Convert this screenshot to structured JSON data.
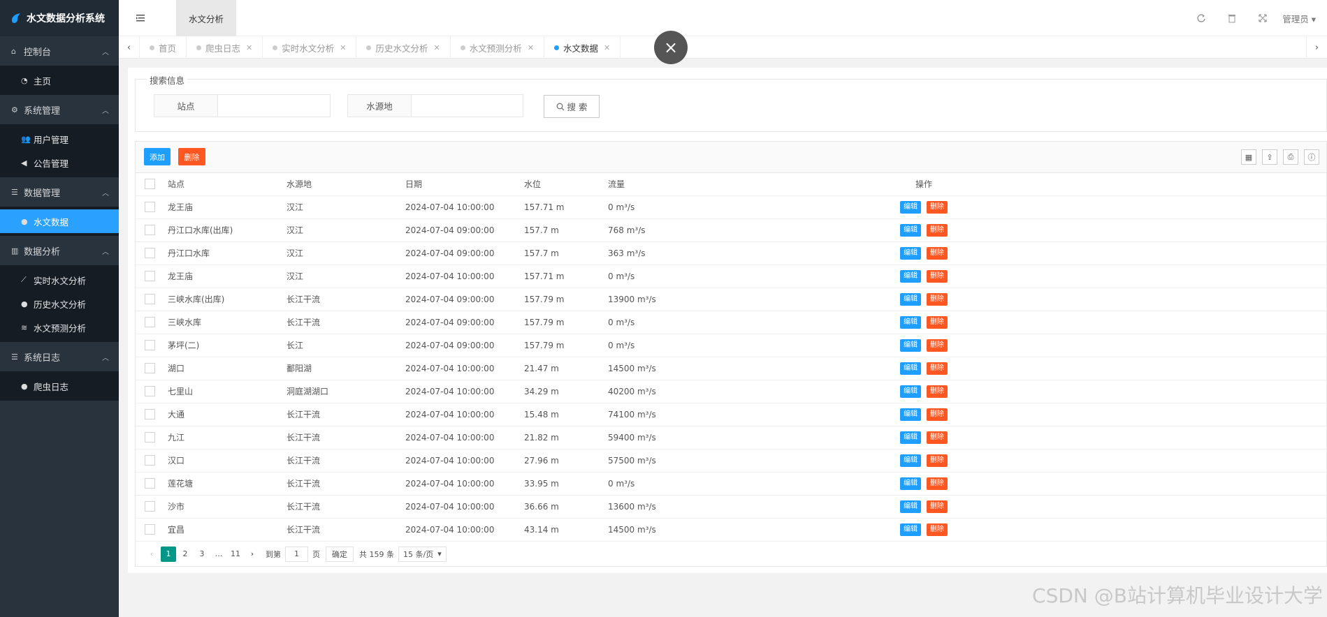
{
  "app": {
    "title": "水文数据分析系统"
  },
  "sidebar": {
    "groups": [
      {
        "label": "控制台",
        "icon": "home-icon",
        "items": [
          {
            "label": "主页",
            "icon": "dashboard-icon"
          }
        ]
      },
      {
        "label": "系统管理",
        "icon": "cogs-icon",
        "items": [
          {
            "label": "用户管理",
            "icon": "users-icon"
          },
          {
            "label": "公告管理",
            "icon": "volume-icon"
          }
        ]
      },
      {
        "label": "数据管理",
        "icon": "list-icon",
        "items": [
          {
            "label": "水文数据",
            "icon": "globe-icon",
            "active": true
          }
        ]
      },
      {
        "label": "数据分析",
        "icon": "bar-chart-icon",
        "items": [
          {
            "label": "实时水文分析",
            "icon": "line-chart-icon"
          },
          {
            "label": "历史水文分析",
            "icon": "globe-icon"
          },
          {
            "label": "水文预测分析",
            "icon": "database-icon"
          }
        ]
      },
      {
        "label": "系统日志",
        "icon": "list-icon",
        "items": [
          {
            "label": "爬虫日志",
            "icon": "globe-icon"
          }
        ]
      }
    ]
  },
  "header": {
    "active_module": "水文分析",
    "admin_label": "管理员"
  },
  "tabs": [
    {
      "label": "首页",
      "closable": false
    },
    {
      "label": "爬虫日志",
      "closable": true
    },
    {
      "label": "实时水文分析",
      "closable": true
    },
    {
      "label": "历史水文分析",
      "closable": true
    },
    {
      "label": "水文预测分析",
      "closable": true
    },
    {
      "label": "水文数据",
      "closable": true,
      "active": true
    }
  ],
  "close_symbol": "×",
  "search": {
    "legend": "搜索信息",
    "station_label": "站点",
    "station_value": "",
    "source_label": "水源地",
    "source_value": "",
    "button_label": "搜 索"
  },
  "toolbar": {
    "add_label": "添加",
    "delete_label": "删除"
  },
  "table": {
    "headers": [
      "站点",
      "水源地",
      "日期",
      "水位",
      "流量",
      "操作"
    ],
    "edit_label": "编辑",
    "delete_label": "删除",
    "rows": [
      [
        "龙王庙",
        "汉江",
        "2024-07-04 10:00:00",
        "157.71 m",
        "0 m³/s"
      ],
      [
        "丹江口水库(出库)",
        "汉江",
        "2024-07-04 09:00:00",
        "157.7 m",
        "768 m³/s"
      ],
      [
        "丹江口水库",
        "汉江",
        "2024-07-04 09:00:00",
        "157.7 m",
        "363 m³/s"
      ],
      [
        "龙王庙",
        "汉江",
        "2024-07-04 10:00:00",
        "157.71 m",
        "0 m³/s"
      ],
      [
        "三峡水库(出库)",
        "长江干流",
        "2024-07-04 09:00:00",
        "157.79 m",
        "13900 m³/s"
      ],
      [
        "三峡水库",
        "长江干流",
        "2024-07-04 09:00:00",
        "157.79 m",
        "0 m³/s"
      ],
      [
        "茅坪(二)",
        "长江",
        "2024-07-04 09:00:00",
        "157.79 m",
        "0 m³/s"
      ],
      [
        "湖口",
        "鄱阳湖",
        "2024-07-04 10:00:00",
        "21.47 m",
        "14500 m³/s"
      ],
      [
        "七里山",
        "洞庭湖湖口",
        "2024-07-04 10:00:00",
        "34.29 m",
        "40200 m³/s"
      ],
      [
        "大通",
        "长江干流",
        "2024-07-04 10:00:00",
        "15.48 m",
        "74100 m³/s"
      ],
      [
        "九江",
        "长江干流",
        "2024-07-04 10:00:00",
        "21.82 m",
        "59400 m³/s"
      ],
      [
        "汉口",
        "长江干流",
        "2024-07-04 10:00:00",
        "27.96 m",
        "57500 m³/s"
      ],
      [
        "莲花塘",
        "长江干流",
        "2024-07-04 10:00:00",
        "33.95 m",
        "0 m³/s"
      ],
      [
        "沙市",
        "长江干流",
        "2024-07-04 10:00:00",
        "36.66 m",
        "13600 m³/s"
      ],
      [
        "宜昌",
        "长江干流",
        "2024-07-04 10:00:00",
        "43.14 m",
        "14500 m³/s"
      ]
    ]
  },
  "pagination": {
    "pages": [
      "1",
      "2",
      "3"
    ],
    "ellipsis": "…",
    "last_page": "11",
    "goto_label": "到第",
    "goto_value": "1",
    "page_unit": "页",
    "confirm_label": "确定",
    "total_label": "共 159 条",
    "page_size_label": "15 条/页"
  },
  "watermark": "CSDN @B站计算机毕业设计大学",
  "colors": {
    "primary": "#1e9fff",
    "danger": "#ff5722",
    "pager_active": "#009688",
    "sidebar_bg": "#28333e"
  }
}
